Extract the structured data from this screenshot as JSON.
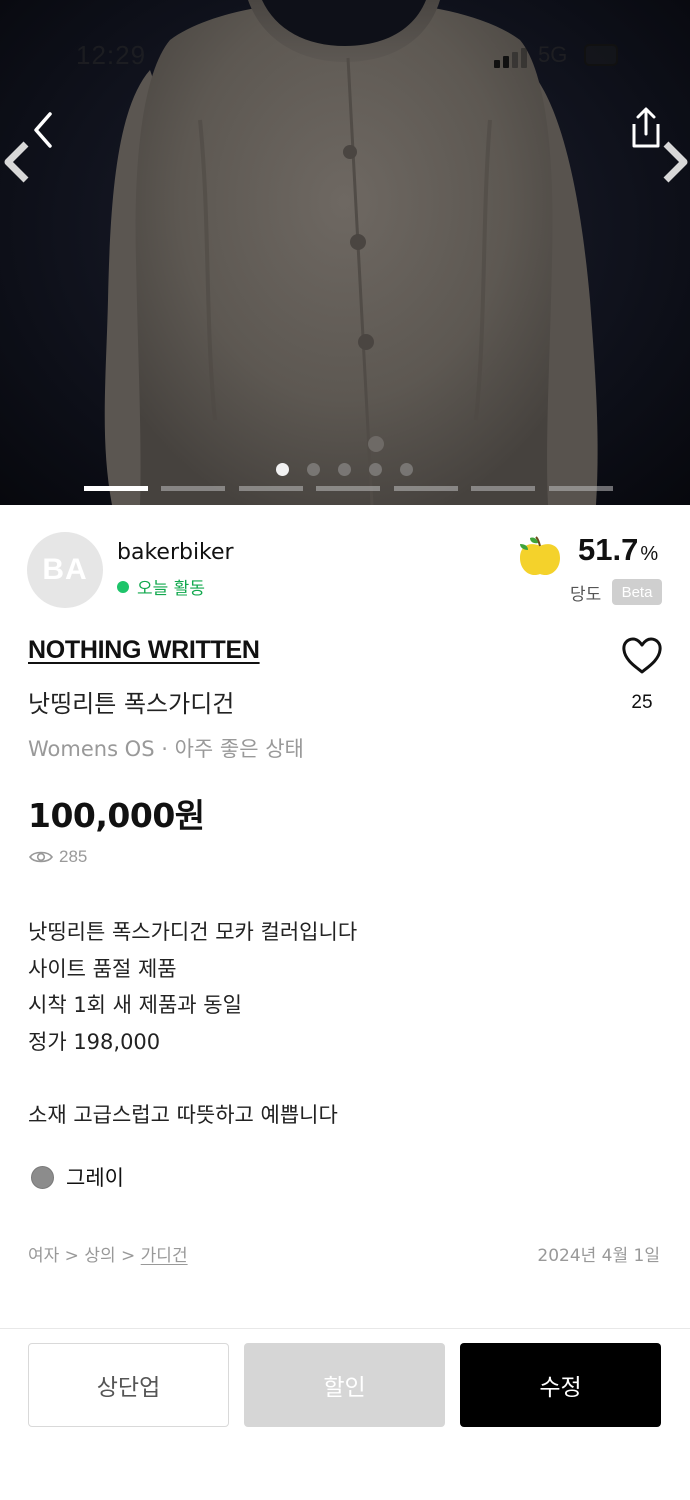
{
  "status_bar": {
    "time": "12:29",
    "network": "5G"
  },
  "gallery": {
    "current_dot": 1,
    "dot_count": 5,
    "current_slide": 1,
    "slide_count": 7
  },
  "seller": {
    "avatar_initials": "BA",
    "name": "bakerbiker",
    "activity": "오늘 활동",
    "sweetness_value": "51.7",
    "sweetness_unit": "%",
    "sweetness_label": "당도",
    "beta_badge": "Beta"
  },
  "product": {
    "brand": "NOTHING WRITTEN",
    "title": "낫띵리튼 폭스가디건",
    "meta": "Womens OS · 아주 좋은 상태",
    "price": "100,000원",
    "views": "285",
    "likes": "25",
    "description": "낫띵리튼 폭스가디건 모카 컬러입니다\n사이트 품절 제품\n시착 1회 새 제품과 동일\n정가 198,000\n\n소재 고급스럽고 따뜻하고 예쁩니다",
    "color_name": "그레이",
    "color_hex": "#8c8c8c",
    "category_prefix": "여자 > 상의 > ",
    "category_leaf": "가디건",
    "date": "2024년 4월 1일"
  },
  "actions": {
    "bump": "상단업",
    "discount": "할인",
    "edit": "수정"
  },
  "colors": {
    "primary": "#000000",
    "active_green": "#1ec46a",
    "disabled": "#d6d6d6"
  }
}
